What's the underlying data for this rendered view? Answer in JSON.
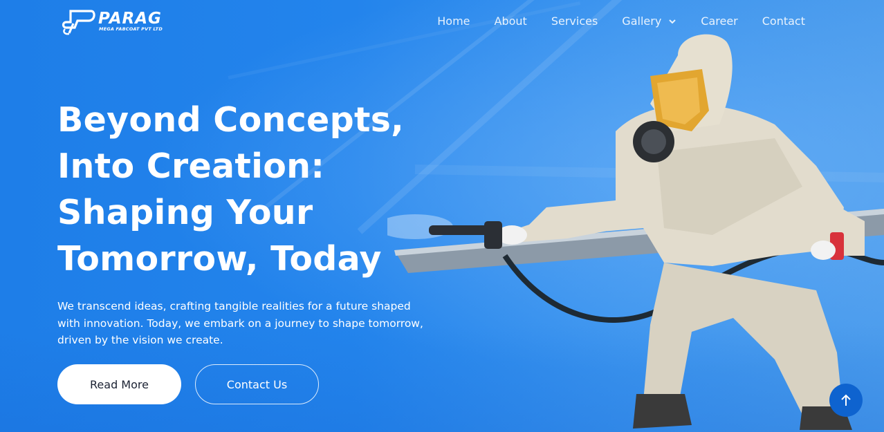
{
  "brand": {
    "name": "PARAG",
    "tagline": "MEGA FABCOAT PVT LTD",
    "logo_icon": "parag-logo-icon"
  },
  "nav": {
    "items": [
      {
        "label": "Home"
      },
      {
        "label": "About"
      },
      {
        "label": "Services"
      },
      {
        "label": "Gallery",
        "has_dropdown": true
      },
      {
        "label": "Career"
      },
      {
        "label": "Contact"
      }
    ]
  },
  "hero": {
    "headline": [
      "Beyond Concepts,",
      "Into Creation:",
      "Shaping Your",
      "Tomorrow, Today"
    ],
    "description": "We transcend ideas, crafting tangible realities for a future shaped with innovation. Today, we embark on a journey to shape tomorrow, driven by the vision we create.",
    "primary_button": "Read More",
    "secondary_button": "Contact Us"
  },
  "scroll_top_icon": "arrow-up-icon",
  "colors": {
    "hero_blue": "#1f7fe6",
    "scroll_button": "#0e63cf",
    "white": "#ffffff"
  }
}
